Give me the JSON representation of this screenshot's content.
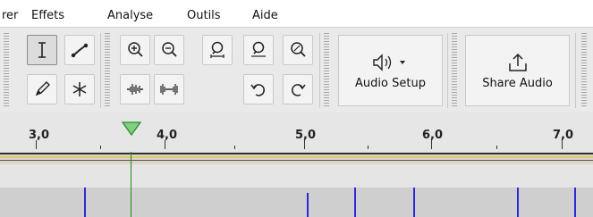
{
  "menubar": {
    "items": [
      "rer",
      "Effets",
      "Analyse",
      "Outils",
      "Aide"
    ]
  },
  "toolbar": {
    "tools": [
      "select-tool",
      "envelope-tool",
      "draw-tool",
      "multi-tool"
    ],
    "zoom": [
      "zoom-in",
      "zoom-out",
      "fit-selection",
      "fit-project",
      "zoom-toggle"
    ],
    "edit": [
      "trim-audio",
      "silence-audio",
      "undo",
      "redo"
    ],
    "audio_setup": {
      "label": "Audio Setup",
      "icon": "speaker-icon"
    },
    "share_audio": {
      "label": "Share Audio",
      "icon": "share-icon"
    }
  },
  "ruler": {
    "labels": [
      "3,0",
      "4,0",
      "5,0",
      "6,0",
      "7,0"
    ]
  },
  "colors": {
    "playhead": "#1b8a1b",
    "clip_boundary": "#2b2bd6",
    "track": "#cfcfcf",
    "ruler": "#e6e6e6",
    "toolbar": "#e9e9e9"
  }
}
